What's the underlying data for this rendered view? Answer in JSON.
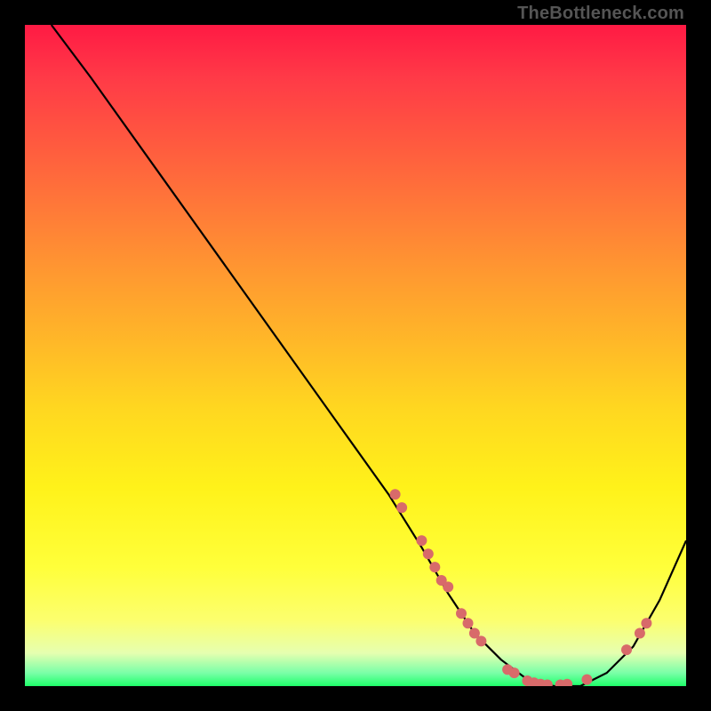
{
  "attribution": "TheBottleneck.com",
  "colors": {
    "background": "#000000",
    "gradient_top": "#ff1a44",
    "gradient_bottom": "#1eff6a",
    "curve": "#000000",
    "dot": "#d86a6a"
  },
  "chart_data": {
    "type": "line",
    "title": "",
    "xlabel": "",
    "ylabel": "",
    "xlim": [
      0,
      100
    ],
    "ylim": [
      0,
      100
    ],
    "series": [
      {
        "name": "curve",
        "x": [
          4,
          10,
          20,
          30,
          40,
          50,
          55,
          60,
          64,
          68,
          72,
          76,
          80,
          84,
          88,
          92,
          96,
          100
        ],
        "y": [
          100,
          92,
          78,
          64,
          50,
          36,
          29,
          21,
          14,
          8,
          4,
          1,
          0,
          0,
          2,
          6,
          13,
          22
        ]
      }
    ],
    "dots": [
      {
        "x": 56,
        "y": 29
      },
      {
        "x": 57,
        "y": 27
      },
      {
        "x": 60,
        "y": 22
      },
      {
        "x": 61,
        "y": 20
      },
      {
        "x": 62,
        "y": 18
      },
      {
        "x": 63,
        "y": 16
      },
      {
        "x": 64,
        "y": 15
      },
      {
        "x": 66,
        "y": 11
      },
      {
        "x": 67,
        "y": 9.5
      },
      {
        "x": 68,
        "y": 8
      },
      {
        "x": 69,
        "y": 6.8
      },
      {
        "x": 73,
        "y": 2.5
      },
      {
        "x": 74,
        "y": 2
      },
      {
        "x": 76,
        "y": 0.8
      },
      {
        "x": 77,
        "y": 0.5
      },
      {
        "x": 78,
        "y": 0.3
      },
      {
        "x": 79,
        "y": 0.2
      },
      {
        "x": 81,
        "y": 0.2
      },
      {
        "x": 82,
        "y": 0.3
      },
      {
        "x": 85,
        "y": 1
      },
      {
        "x": 91,
        "y": 5.5
      },
      {
        "x": 93,
        "y": 8
      },
      {
        "x": 94,
        "y": 9.5
      }
    ]
  }
}
